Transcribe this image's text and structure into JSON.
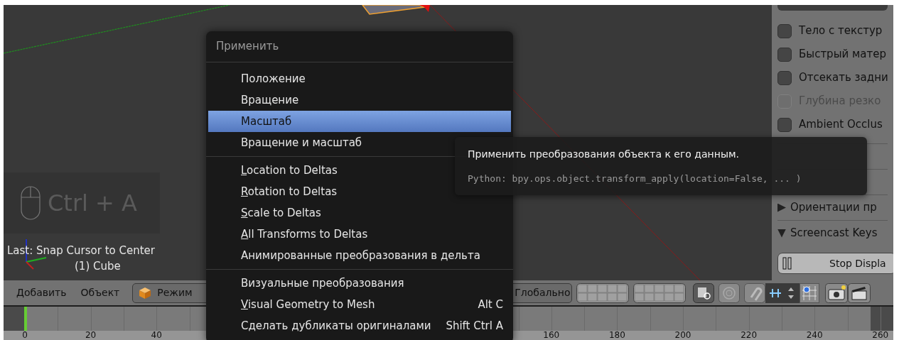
{
  "viewport": {
    "screencast_keys": "Ctrl + A",
    "last_operator": "Last: Snap Cursor to Center",
    "object_info": "(1) Cube"
  },
  "menu": {
    "title": "Применить",
    "sections": [
      [
        {
          "label": "Положение",
          "selected": false,
          "mnemonic": false
        },
        {
          "label": "Вращение",
          "selected": false,
          "mnemonic": false
        },
        {
          "label": "Масштаб",
          "selected": true,
          "mnemonic": false
        },
        {
          "label": "Вращение и масштаб",
          "selected": false,
          "mnemonic": false
        }
      ],
      [
        {
          "label": "Location to Deltas",
          "selected": false,
          "mnemonic": true
        },
        {
          "label": "Rotation to Deltas",
          "selected": false,
          "mnemonic": true
        },
        {
          "label": "Scale to Deltas",
          "selected": false,
          "mnemonic": true
        },
        {
          "label": "All Transforms to Deltas",
          "selected": false,
          "mnemonic": true
        },
        {
          "label": "Анимированные преобразования в дельта",
          "selected": false,
          "mnemonic": false
        }
      ],
      [
        {
          "label": "Визуальные преобразования",
          "selected": false,
          "mnemonic": false
        },
        {
          "label": "Visual Geometry to Mesh",
          "shortcut": "Alt C",
          "selected": false,
          "mnemonic": true
        },
        {
          "label": "Сделать дубликаты оригиналами",
          "shortcut": "Shift Ctrl A",
          "selected": false,
          "mnemonic": false
        }
      ]
    ]
  },
  "tooltip": {
    "description": "Применить преобразования объекта к его данным.",
    "python": "Python: bpy.ops.object.transform_apply(location=False, ... )"
  },
  "properties_panel": {
    "checkboxes": [
      {
        "label": "Тело с текстур",
        "checked": false,
        "disabled": false
      },
      {
        "label": "Быстрый матер",
        "checked": false,
        "disabled": false
      },
      {
        "label": "Отсекать задни",
        "checked": false,
        "disabled": false
      },
      {
        "label": "Глубина резко",
        "checked": false,
        "disabled": true
      },
      {
        "label": "Ambient Occlus",
        "checked": false,
        "disabled": false
      }
    ],
    "subpanels": [
      {
        "label": "Ориентации пр",
        "expanded": false
      },
      {
        "label": "Screencast Keys",
        "expanded": true
      }
    ],
    "button": "Stop Displa"
  },
  "header": {
    "menus": [
      "Добавить",
      "Объект"
    ],
    "mode": "Режим",
    "orientation": "Глобально"
  },
  "timeline": {
    "ruler": [
      "0",
      "20",
      "40",
      "160",
      "180",
      "200",
      "220",
      "240",
      "260"
    ]
  }
}
